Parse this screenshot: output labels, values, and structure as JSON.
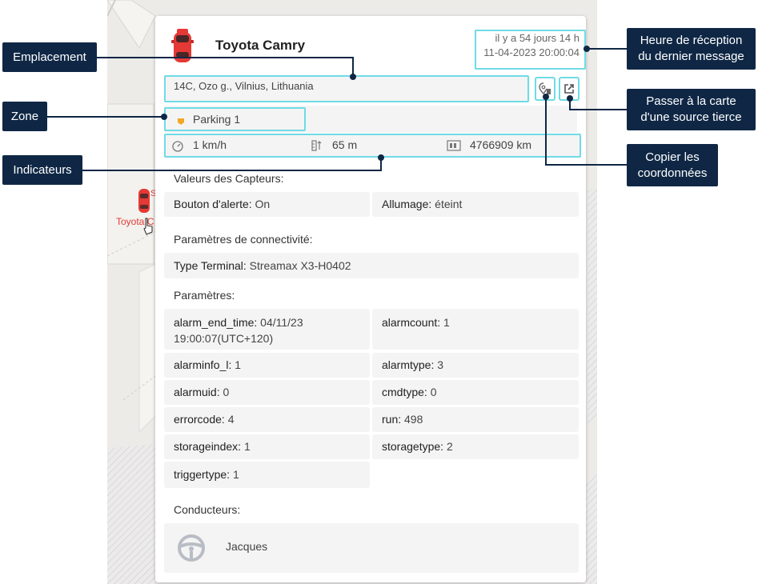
{
  "vehicle": {
    "name": "Toyota Camry",
    "time_ago": "il y a 54 jours 14 h",
    "timestamp": "11-04-2023 20:00:04",
    "address": "14C, Ozo g., Vilnius, Lithuania",
    "zone": "Parking 1",
    "speed": "1 km/h",
    "altitude": "65 m",
    "mileage": "4766909 km"
  },
  "map": {
    "marker_label": "Toyota C",
    "marker_label_extra": "S"
  },
  "sections": {
    "sensors_title": "Valeurs des Capteurs:",
    "connectivity_title": "Paramètres de connectivité:",
    "params_title": "Paramètres:",
    "drivers_title": "Conducteurs:"
  },
  "sensors": [
    {
      "key": "Bouton d'alerte:",
      "value": "On"
    },
    {
      "key": "Allumage:",
      "value": "éteint"
    }
  ],
  "connectivity": [
    {
      "key": "Type Terminal:",
      "value": "Streamax X3-H0402"
    }
  ],
  "params": [
    {
      "key": "alarm_end_time:",
      "value": "04/11/23",
      "value2": "19:00:07(UTC+120)"
    },
    {
      "key": "alarmcount:",
      "value": "1"
    },
    {
      "key": "alarminfo_l:",
      "value": "1"
    },
    {
      "key": "alarmtype:",
      "value": "3"
    },
    {
      "key": "alarmuid:",
      "value": "0"
    },
    {
      "key": "cmdtype:",
      "value": "0"
    },
    {
      "key": "errorcode:",
      "value": "4"
    },
    {
      "key": "run:",
      "value": "498"
    },
    {
      "key": "storageindex:",
      "value": "1"
    },
    {
      "key": "storagetype:",
      "value": "2"
    },
    {
      "key": "triggertype:",
      "value": "1"
    }
  ],
  "driver": {
    "name": "Jacques"
  },
  "callouts": {
    "emplacement": "Emplacement",
    "zone": "Zone",
    "indicateurs": "Indicateurs",
    "heure_line1": "Heure de réception",
    "heure_line2": "du dernier message",
    "passer_line1": "Passer à la carte",
    "passer_line2": "d'une source tierce",
    "copier_line1": "Copier les",
    "copier_line2": "coordonnées"
  },
  "colors": {
    "highlight": "#6fdbe6",
    "callout_bg": "#0f2745",
    "zone_icon": "#f5a623",
    "car": "#e53935"
  }
}
